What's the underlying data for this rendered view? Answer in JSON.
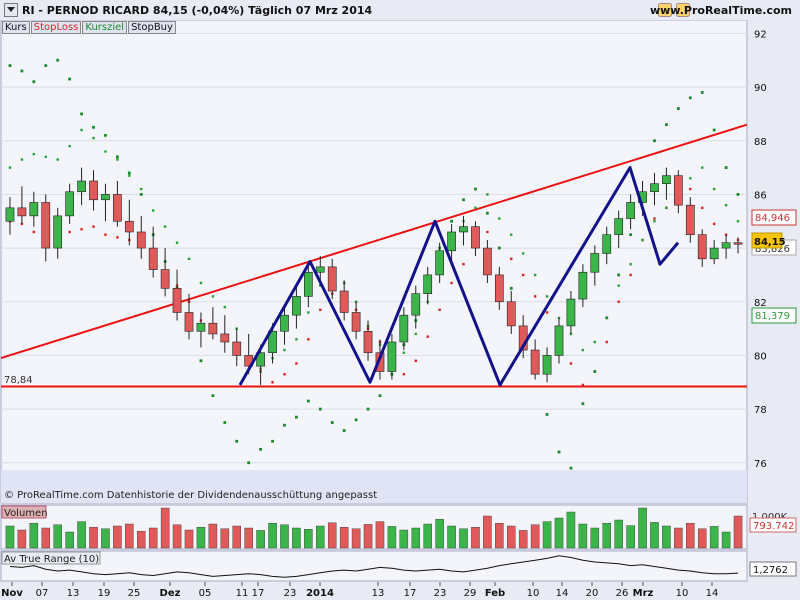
{
  "header": {
    "ticker_line": "RI - PERNOD RICARD      84,15 (-0,04%)      Täglich  07 Mrz 2014",
    "site": "www.ProRealTime.com"
  },
  "legend": {
    "kurs": "Kurs",
    "stoploss": "StopLoss",
    "kursziel": "Kursziel",
    "stopbuy": "StopBuy"
  },
  "footer_note": "© ProRealTime.com  Datenhistorie der Dividendenausschüttung angepasst",
  "panels": {
    "volume_label": "Volumen",
    "volume_tick": "1.000K",
    "volume_value": "793.742",
    "atr_label": "Av True Range (10)",
    "atr_value": "1,2762"
  },
  "price_labels": {
    "support": "78,84",
    "stoploss": "84,946",
    "last": "84,15",
    "hidden": "83,826",
    "target": "81,379"
  },
  "colors": {
    "up": "#2ea43a",
    "down": "#d94b4b",
    "trend": "#ee1111",
    "zigzag": "#12128a",
    "stopbuy": "#1a8a2a"
  },
  "chart_data": {
    "type": "candlestick",
    "title": "RI - PERNOD RICARD",
    "ylim": [
      74.5,
      92.5
    ],
    "y_ticks": [
      76,
      78,
      80,
      82,
      84,
      86,
      88,
      90,
      92
    ],
    "x_tick_labels": [
      "Nov",
      "07",
      "13",
      "19",
      "25",
      "Dez",
      "05",
      "11",
      "17",
      "23",
      "2014",
      "13",
      "17",
      "23",
      "29",
      "Feb",
      "10",
      "14",
      "20",
      "26",
      "Mrz",
      "10",
      "14"
    ],
    "support_level": 78.84,
    "trend_line": {
      "start": 79.9,
      "end": 88.6
    },
    "zigzag": [
      78.9,
      83.5,
      79.0,
      85.0,
      78.9,
      87.0,
      83.4,
      84.2
    ],
    "last_price": 84.15,
    "change": "-0,04%",
    "candles": [
      [
        85.0,
        85.9,
        84.5,
        85.5
      ],
      [
        85.5,
        86.3,
        84.9,
        85.2
      ],
      [
        85.2,
        86.1,
        84.8,
        85.7
      ],
      [
        85.7,
        86.0,
        83.5,
        84.0
      ],
      [
        84.0,
        85.5,
        83.6,
        85.2
      ],
      [
        85.2,
        86.4,
        84.9,
        86.1
      ],
      [
        86.1,
        87.0,
        85.6,
        86.5
      ],
      [
        86.5,
        86.9,
        85.4,
        85.8
      ],
      [
        85.8,
        86.4,
        85.0,
        86.0
      ],
      [
        86.0,
        86.5,
        84.8,
        85.0
      ],
      [
        85.0,
        85.8,
        84.1,
        84.6
      ],
      [
        84.6,
        85.2,
        83.6,
        84.0
      ],
      [
        84.0,
        84.8,
        82.9,
        83.2
      ],
      [
        83.2,
        84.0,
        82.2,
        82.5
      ],
      [
        82.5,
        83.2,
        81.3,
        81.6
      ],
      [
        81.6,
        82.3,
        80.6,
        80.9
      ],
      [
        80.9,
        81.6,
        80.3,
        81.2
      ],
      [
        81.2,
        81.8,
        80.6,
        80.8
      ],
      [
        80.8,
        81.5,
        80.1,
        80.5
      ],
      [
        80.5,
        81.0,
        79.6,
        80.0
      ],
      [
        80.0,
        80.8,
        79.3,
        79.6
      ],
      [
        79.6,
        80.4,
        78.9,
        80.1
      ],
      [
        80.1,
        81.2,
        79.7,
        80.9
      ],
      [
        80.9,
        81.8,
        80.4,
        81.5
      ],
      [
        81.5,
        82.6,
        81.0,
        82.2
      ],
      [
        82.2,
        83.4,
        81.8,
        83.1
      ],
      [
        83.1,
        83.7,
        82.6,
        83.3
      ],
      [
        83.3,
        83.6,
        82.1,
        82.4
      ],
      [
        82.4,
        82.8,
        81.3,
        81.6
      ],
      [
        81.6,
        82.0,
        80.6,
        80.9
      ],
      [
        80.9,
        81.3,
        79.8,
        80.1
      ],
      [
        80.1,
        80.6,
        79.1,
        79.4
      ],
      [
        79.4,
        80.8,
        79.1,
        80.5
      ],
      [
        80.5,
        81.8,
        80.2,
        81.5
      ],
      [
        81.5,
        82.6,
        81.0,
        82.3
      ],
      [
        82.3,
        83.3,
        81.9,
        83.0
      ],
      [
        83.0,
        84.2,
        82.7,
        83.9
      ],
      [
        83.9,
        84.9,
        83.4,
        84.6
      ],
      [
        84.6,
        85.2,
        84.1,
        84.8
      ],
      [
        84.8,
        85.0,
        83.7,
        84.0
      ],
      [
        84.0,
        84.3,
        82.7,
        83.0
      ],
      [
        83.0,
        83.3,
        81.7,
        82.0
      ],
      [
        82.0,
        82.4,
        80.8,
        81.1
      ],
      [
        81.1,
        81.5,
        79.9,
        80.2
      ],
      [
        80.2,
        80.6,
        79.1,
        79.3
      ],
      [
        79.3,
        80.3,
        79.0,
        80.0
      ],
      [
        80.0,
        81.4,
        79.7,
        81.1
      ],
      [
        81.1,
        82.4,
        80.8,
        82.1
      ],
      [
        82.1,
        83.4,
        81.8,
        83.1
      ],
      [
        83.1,
        84.1,
        82.6,
        83.8
      ],
      [
        83.8,
        84.8,
        83.4,
        84.5
      ],
      [
        84.5,
        85.4,
        84.0,
        85.1
      ],
      [
        85.1,
        86.0,
        84.7,
        85.7
      ],
      [
        85.7,
        86.5,
        85.2,
        86.1
      ],
      [
        86.1,
        86.8,
        85.6,
        86.4
      ],
      [
        86.4,
        87.0,
        85.8,
        86.7
      ],
      [
        86.7,
        86.9,
        85.3,
        85.6
      ],
      [
        85.6,
        85.9,
        84.2,
        84.5
      ],
      [
        84.5,
        84.7,
        83.3,
        83.6
      ],
      [
        83.6,
        84.3,
        83.4,
        84.0
      ],
      [
        84.0,
        84.5,
        83.6,
        84.2
      ],
      [
        84.2,
        84.4,
        83.8,
        84.15
      ]
    ],
    "stoploss_dots": [
      85.0,
      84.9,
      84.6,
      84.4,
      84.5,
      84.6,
      84.7,
      84.8,
      84.5,
      84.4,
      84.3,
      84.2,
      83.6,
      83.0,
      82.6,
      82.0,
      81.3,
      81.0,
      80.6,
      80.2,
      79.7,
      79.4,
      79.0,
      79.3,
      79.7,
      80.6,
      81.7,
      82.3,
      82.7,
      81.7,
      81.0,
      80.5,
      79.6,
      79.3,
      79.8,
      80.7,
      81.7,
      82.7,
      83.4,
      84.2,
      84.6,
      84.0,
      83.6,
      83.0,
      82.2,
      81.6,
      80.6,
      79.7,
      78.9,
      79.4,
      80.5,
      82.0,
      83.0,
      84.3,
      85.1,
      85.5,
      85.8,
      86.2,
      85.5,
      84.9,
      84.5,
      84.3
    ],
    "kursziel_dots": [
      87.0,
      87.3,
      87.5,
      87.4,
      87.3,
      87.8,
      88.4,
      88.1,
      87.6,
      87.3,
      86.7,
      86.2,
      85.4,
      84.8,
      84.2,
      83.6,
      82.7,
      82.2,
      81.8,
      81.0,
      79.9,
      79.5,
      79.9,
      80.2,
      80.6,
      81.6,
      82.6,
      83.2,
      82.7,
      82.0,
      81.1,
      80.4,
      79.8,
      80.1,
      80.8,
      82.0,
      83.4,
      84.2,
      85.0,
      85.5,
      86.0,
      85.1,
      84.5,
      83.8,
      83.0,
      82.2,
      81.4,
      80.8,
      80.2,
      80.5,
      81.4,
      82.6,
      83.4,
      84.3,
      85.0,
      85.5,
      86.0,
      86.6,
      87.0,
      86.2,
      85.6,
      85.0
    ],
    "stopbuy_dots": [
      90.8,
      90.6,
      90.2,
      90.8,
      91.0,
      90.3,
      89.0,
      88.5,
      88.2,
      87.4,
      86.8,
      86.0,
      84.5,
      83.5,
      82.5,
      81.3,
      79.8,
      78.5,
      77.5,
      76.8,
      76.0,
      76.5,
      76.8,
      77.4,
      77.7,
      78.3,
      78.0,
      77.5,
      77.2,
      77.6,
      78.0,
      78.5,
      79.3,
      80.4,
      81.3,
      82.5,
      84.0,
      85.0,
      85.8,
      86.2,
      85.3,
      84.0,
      82.5,
      81.0,
      79.8,
      77.8,
      76.4,
      75.8,
      78.2,
      79.4,
      81.4,
      83.0,
      84.5,
      86.0,
      88.0,
      88.6,
      89.2,
      89.6,
      89.8,
      88.4,
      87.0,
      86.0
    ],
    "volume": [
      0.55,
      0.45,
      0.62,
      0.5,
      0.58,
      0.4,
      0.66,
      0.52,
      0.48,
      0.55,
      0.6,
      0.42,
      0.5,
      1.0,
      0.58,
      0.45,
      0.52,
      0.6,
      0.48,
      0.55,
      0.5,
      0.44,
      0.62,
      0.58,
      0.5,
      0.47,
      0.55,
      0.63,
      0.52,
      0.48,
      0.59,
      0.66,
      0.54,
      0.45,
      0.5,
      0.6,
      0.72,
      0.55,
      0.48,
      0.52,
      0.8,
      0.62,
      0.55,
      0.44,
      0.58,
      0.66,
      0.75,
      0.9,
      0.6,
      0.5,
      0.62,
      0.7,
      0.56,
      1.0,
      0.64,
      0.55,
      0.5,
      0.62,
      0.48,
      0.54,
      0.4,
      0.8
    ],
    "atr": [
      1.35,
      1.34,
      1.36,
      1.32,
      1.3,
      1.31,
      1.29,
      1.27,
      1.26,
      1.27,
      1.28,
      1.26,
      1.25,
      1.27,
      1.29,
      1.28,
      1.26,
      1.24,
      1.25,
      1.26,
      1.27,
      1.26,
      1.24,
      1.23,
      1.24,
      1.26,
      1.28,
      1.3,
      1.31,
      1.3,
      1.32,
      1.34,
      1.33,
      1.31,
      1.3,
      1.31,
      1.32,
      1.3,
      1.29,
      1.31,
      1.33,
      1.36,
      1.38,
      1.4,
      1.42,
      1.44,
      1.47,
      1.45,
      1.42,
      1.4,
      1.39,
      1.38,
      1.36,
      1.37,
      1.35,
      1.33,
      1.31,
      1.3,
      1.28,
      1.27,
      1.27,
      1.276
    ]
  }
}
